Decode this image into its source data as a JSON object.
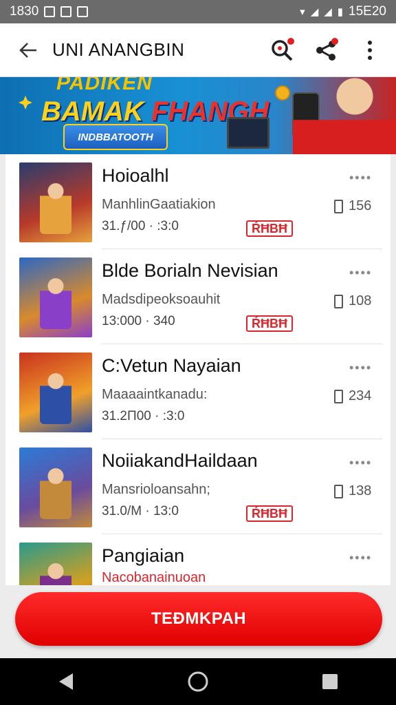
{
  "status_bar": {
    "time": "1830",
    "battery_time": "15E20"
  },
  "app_bar": {
    "title": "UNI ANANGBIN",
    "back_icon": "arrow-left-icon",
    "actions": [
      "search-icon",
      "share-icon",
      "more-vert-icon"
    ]
  },
  "banner": {
    "line1": "PADIKEN",
    "line2_part1": "BAMAK ",
    "line2_part2": "FHANGH",
    "chip": "INDBBATOOTH"
  },
  "items": [
    {
      "title": "Hoioalhl",
      "subtitle": "ManhlinGaatiakion",
      "time": "31.ƒ/00 · :3:0",
      "badge": "ŔĦBĦ",
      "count": "156",
      "thumb_colors": [
        "#2a3c6e",
        "#b83a2a",
        "#e6a23c"
      ]
    },
    {
      "title": "Blde Borialn Nevisian",
      "subtitle": "Madsdipeoksoauhit",
      "time": "13:000 · 340",
      "badge": "ŔĦBĦ",
      "count": "108",
      "thumb_colors": [
        "#2b68c4",
        "#d98a2c",
        "#8a3fc9"
      ]
    },
    {
      "title": "C:Vetun Nayaian",
      "subtitle": "Maaaaintkanadu:",
      "time": "31.2Π00 · :3:0",
      "badge": "",
      "count": "234",
      "thumb_colors": [
        "#c9321f",
        "#f0a02a",
        "#2e4fa6"
      ]
    },
    {
      "title": "NoiiakandHaildaan",
      "subtitle": "Mansrioloansahn;",
      "time": "31.0/M · 13:0",
      "badge": "ŔĦBĦ",
      "count": "138",
      "thumb_colors": [
        "#2c7bd6",
        "#6a4b9e",
        "#c28a3a"
      ]
    },
    {
      "title": "Pangiaian",
      "subtitle": "Nacobanainuoan",
      "time": "",
      "badge": "",
      "count": "",
      "thumb_colors": [
        "#2a9a8c",
        "#d4a020",
        "#7a2f8a"
      ]
    }
  ],
  "cta": {
    "label": "TEĐMKPAH"
  },
  "colors": {
    "accent": "#e00000",
    "badge": "#d9262c"
  }
}
